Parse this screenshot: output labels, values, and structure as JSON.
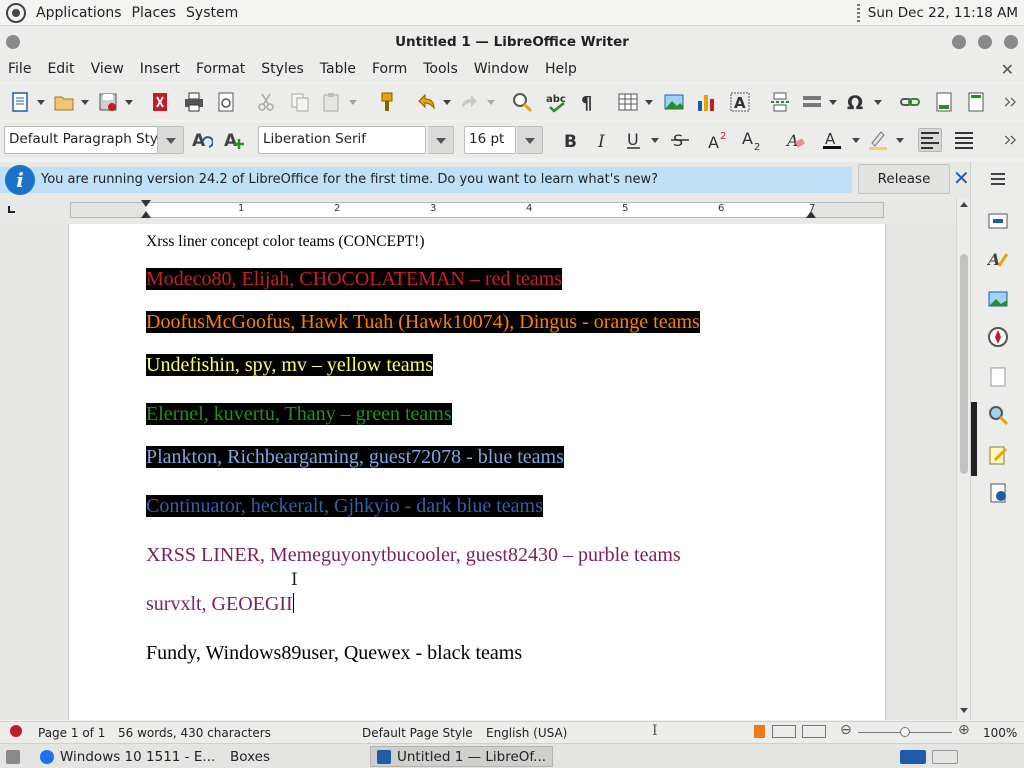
{
  "top_panel": {
    "menus": [
      "Applications",
      "Places",
      "System"
    ],
    "clock": "Sun Dec 22, 11:18 AM"
  },
  "window": {
    "title": "Untitled 1 — LibreOffice Writer"
  },
  "menu_bar": [
    "File",
    "Edit",
    "View",
    "Insert",
    "Format",
    "Styles",
    "Table",
    "Form",
    "Tools",
    "Window",
    "Help"
  ],
  "formatting": {
    "paragraph_style": "Default Paragraph Style",
    "font_name": "Liberation Serif",
    "font_size": "16 pt"
  },
  "infobar": {
    "message": "You are running version 24.2 of LibreOffice for the first time. Do you want to learn what's new?",
    "button": "Release Notes"
  },
  "ruler": {
    "labels": [
      "1",
      "2",
      "3",
      "4",
      "5",
      "6",
      "7"
    ]
  },
  "document": {
    "lines": [
      {
        "text": "Xrss liner concept color teams (CONCEPT!)",
        "color": "#000000",
        "highlight": false
      },
      {
        "text": "Modeco80, Elijah, CHOCOLATEMAN – red teams",
        "color": "#c9211e",
        "highlight": true
      },
      {
        "text": "DoofusMcGoofus, Hawk  Tuah (Hawk10074), Dingus - orange teams",
        "color": "#ff8000",
        "highlight": true
      },
      {
        "text": "Undefishin, spy, mv – yellow teams",
        "color": "#ffff66",
        "highlight": true
      },
      {
        "text": "Elernel, kuvertu, Thany – green teams",
        "color": "#2a8c2a",
        "highlight": true
      },
      {
        "text": "Plankton, Richbeargaming, guest72078 - blue teams",
        "color": "#7fa7e0",
        "highlight": true
      },
      {
        "text": "Continuator, heckeralt, Gjhkyio - dark blue teams",
        "color": "#3c5ea8",
        "highlight": true
      },
      {
        "text": "XRSS LINER, Memeguyonytbucooler, guest82430 – purble teams",
        "color": "#7b1f5e",
        "highlight": false
      },
      {
        "text": "survxlt, GEOEGII",
        "color": "#7b1f5e",
        "highlight": false
      },
      {
        "text": "Fundy, Windows89user, Quewex - black teams",
        "color": "#000000",
        "highlight": false
      }
    ]
  },
  "status_bar": {
    "page": "Page 1 of 1",
    "words": "56 words, 430 characters",
    "page_style": "Default Page Style",
    "language": "English (USA)",
    "zoom": "100%",
    "zoom_value": 1.0
  },
  "taskbar": {
    "tasks": [
      "Windows 10 1511 - E...",
      "Boxes",
      "Untitled 1 — LibreOf..."
    ]
  },
  "icons": {
    "toolbar": [
      "new-document-icon",
      "open-icon",
      "save-icon",
      "export-pdf-icon",
      "print-icon",
      "print-preview-icon",
      "cut-icon",
      "copy-icon",
      "paste-icon",
      "clone-formatting-icon",
      "undo-icon",
      "redo-icon",
      "find-replace-icon",
      "spelling-icon",
      "formatting-marks-icon",
      "table-icon",
      "image-icon",
      "chart-icon",
      "text-box-icon",
      "page-break-icon",
      "field-icon",
      "special-character-icon",
      "hyperlink-icon",
      "footnote-icon",
      "header-footer-icon"
    ]
  }
}
